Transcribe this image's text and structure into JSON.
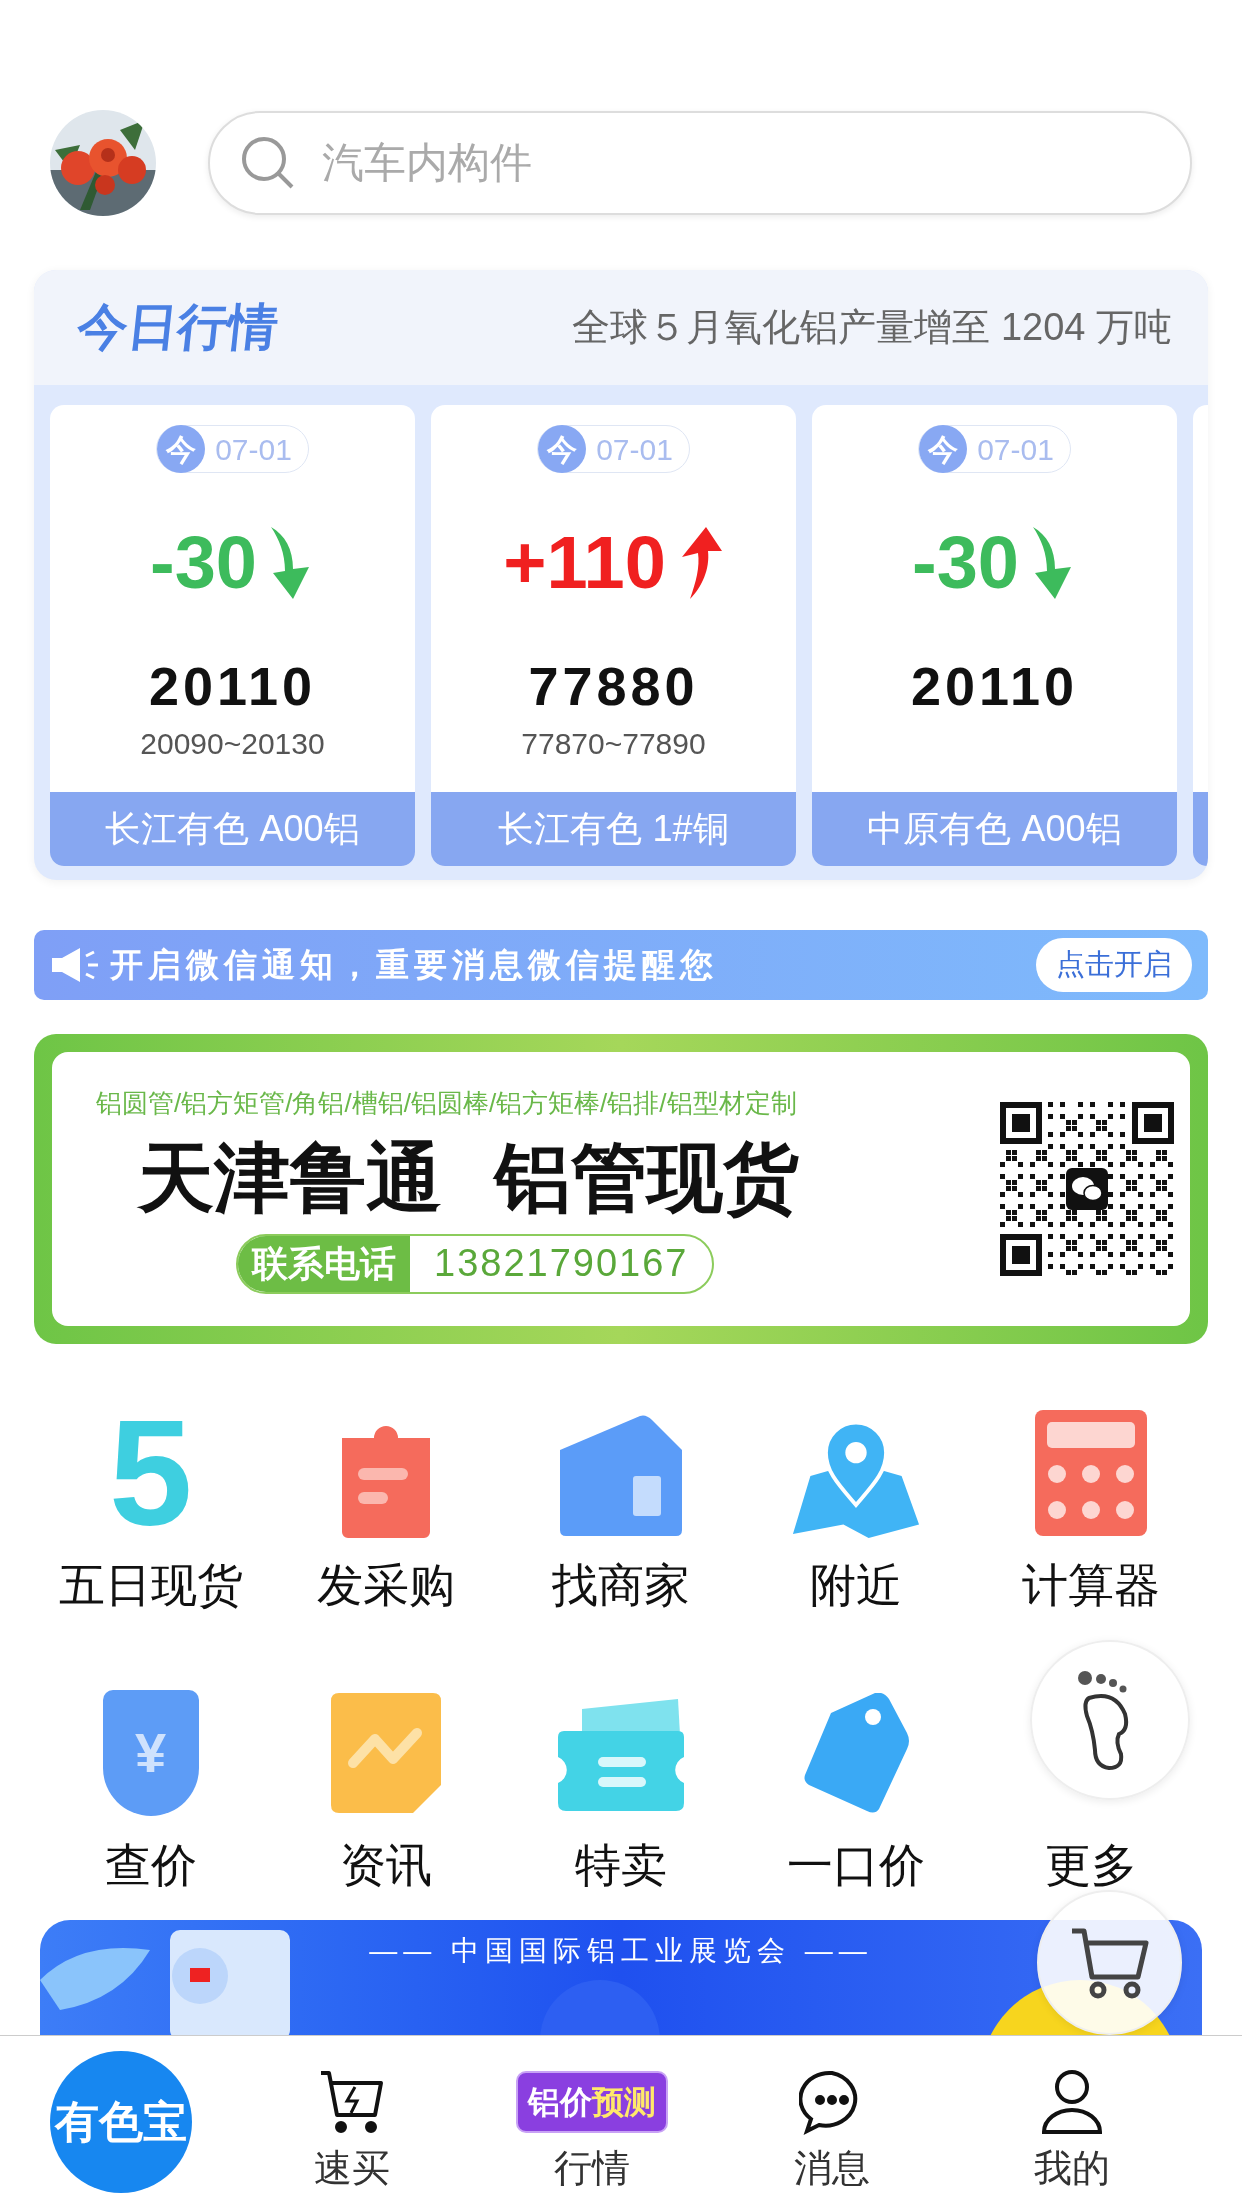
{
  "search": {
    "placeholder": "汽车内构件"
  },
  "market": {
    "title": "今日行情",
    "news": "全球５月氧化铝产量增至 1204 万吨",
    "cards": [
      {
        "badge": "今",
        "date": "07-01",
        "change": "-30",
        "kind": "down",
        "price": "20110",
        "range": "20090~20130",
        "name": "长江有色 A00铝"
      },
      {
        "badge": "今",
        "date": "07-01",
        "change": "+110",
        "kind": "up",
        "price": "77880",
        "range": "77870~77890",
        "name": "长江有色 1#铜"
      },
      {
        "badge": "今",
        "date": "07-01",
        "change": "-30",
        "kind": "down",
        "price": "20110",
        "name": "中原有色 A00铝"
      }
    ]
  },
  "notice": {
    "text": "开启微信通知，重要消息微信提醒您",
    "button": "点击开启"
  },
  "ad": {
    "products": "铝圆管/铝方矩管/角铝/槽铝/铝圆棒/铝方矩棒/铝排/铝型材定制",
    "headline": "天津鲁通  铝管现货",
    "contact_label": "联系电话",
    "phone": "13821790167"
  },
  "shortcuts": [
    {
      "kind": "five",
      "glyph": "5",
      "label": "五日现货"
    },
    {
      "kind": "clipboard",
      "label": "发采购"
    },
    {
      "kind": "house",
      "label": "找商家"
    },
    {
      "kind": "map",
      "label": "附近"
    },
    {
      "kind": "calculator",
      "label": "计算器"
    },
    {
      "kind": "yen",
      "glyph": "¥",
      "label": "查价"
    },
    {
      "kind": "chart",
      "label": "资讯"
    },
    {
      "kind": "ticket",
      "label": "特卖"
    },
    {
      "kind": "tag",
      "label": "一口价"
    },
    {
      "kind": "more",
      "label": "更多"
    }
  ],
  "event_banner": {
    "subtitle": "—— 中国国际铝工业展览会 ——"
  },
  "tabbar": [
    {
      "kind": "logo",
      "label": "有色宝",
      "selected": true
    },
    {
      "kind": "cart",
      "label": "速买",
      "selected": false
    },
    {
      "kind": "badge",
      "badge_1": "铝价",
      "badge_2": "预测",
      "label": "行情",
      "selected": false
    },
    {
      "kind": "chat",
      "label": "消息",
      "selected": false
    },
    {
      "kind": "user",
      "label": "我的",
      "selected": false
    }
  ]
}
